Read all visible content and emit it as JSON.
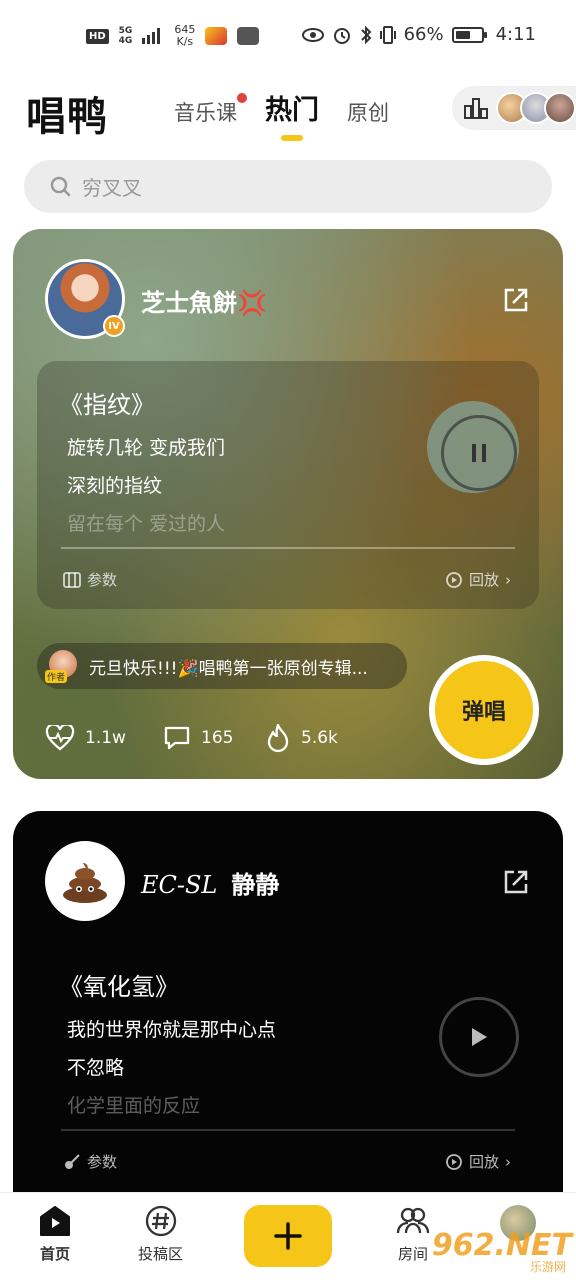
{
  "status_bar": {
    "hd": "HD",
    "signal_top": "5G",
    "signal_bottom": "4G",
    "speed_value": "645",
    "speed_unit": "K/s",
    "battery_percent": "66%",
    "battery_level": 0.66,
    "time": "4:11"
  },
  "header": {
    "logo": "唱鸭",
    "tabs": [
      {
        "label": "音乐课",
        "has_dot": true
      },
      {
        "label": "热门",
        "active": true
      },
      {
        "label": "原创"
      }
    ]
  },
  "search": {
    "placeholder": "穷叉叉"
  },
  "cards": [
    {
      "user": "芝士魚餅💢",
      "level": "IV",
      "song_title": "《指纹》",
      "lyrics": [
        "旋转几轮 变成我们",
        "深刻的指纹",
        "留在每个 爱过的人"
      ],
      "params_label": "参数",
      "replay_label": "回放",
      "comment_author_tag": "作者",
      "comment_text": "元旦快乐!!!🎉唱鸭第一张原创专辑...",
      "stats": {
        "likes": "1.1w",
        "comments": "165",
        "hot": "5.6k"
      },
      "sing_button": "弹唱"
    },
    {
      "user_en": "EC-SL",
      "user": "静静",
      "song_title": "《氧化氢》",
      "lyrics": [
        "我的世界你就是那中心点",
        "不忽略",
        "化学里面的反应"
      ],
      "params_label": "参数",
      "replay_label": "回放"
    }
  ],
  "bottom_nav": {
    "items": [
      {
        "label": "首页",
        "active": true
      },
      {
        "label": "投稿区"
      },
      {
        "label": "房间"
      }
    ]
  },
  "watermark": {
    "main": "962.NET",
    "sub": "乐游网"
  },
  "colors": {
    "accent": "#f5c518",
    "dot": "#e0433a"
  }
}
